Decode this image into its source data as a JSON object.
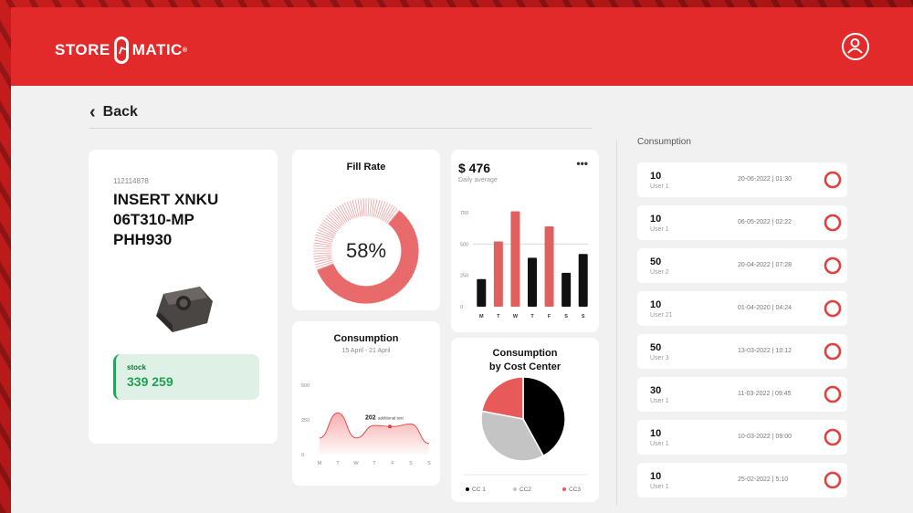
{
  "header": {
    "logo_left": "STORE",
    "logo_right": "MATIC",
    "logo_reg": "®"
  },
  "nav": {
    "back_label": "Back"
  },
  "product": {
    "code": "112114878",
    "name_lines": [
      "INSERT XNKU",
      "06T310-MP",
      "PHH930"
    ],
    "stock_label": "stock",
    "stock_value": "339 259"
  },
  "fill_rate": {
    "title": "Fill Rate",
    "percent": 58,
    "label": "58%"
  },
  "daily_average": {
    "amount": "$ 476",
    "subtitle": "Daily average",
    "menu": "•••",
    "chart_data": {
      "type": "bar",
      "categories": [
        "M",
        "T",
        "W",
        "T",
        "F",
        "S",
        "S"
      ],
      "series": [
        {
          "color": "#111111",
          "values": [
            220,
            0,
            0,
            390,
            0,
            270,
            420
          ]
        },
        {
          "color": "#e06060",
          "values": [
            0,
            520,
            760,
            0,
            640,
            0,
            0
          ]
        }
      ],
      "values": [
        220,
        520,
        760,
        390,
        640,
        270,
        420
      ],
      "colors": [
        "#111111",
        "#e06060",
        "#e06060",
        "#111111",
        "#e06060",
        "#111111",
        "#111111"
      ],
      "yticks": [
        "750",
        "500",
        "250",
        "0"
      ],
      "ylim": [
        0,
        800
      ]
    }
  },
  "consumption_chart": {
    "title": "Consumption",
    "range": "15 April - 21 April",
    "annotation_value": "202",
    "annotation_text": "additional text",
    "chart_data": {
      "type": "area",
      "categories": [
        "M",
        "T",
        "W",
        "T",
        "F",
        "S",
        "S"
      ],
      "values": [
        120,
        300,
        120,
        210,
        202,
        220,
        80
      ],
      "yticks": [
        "500",
        "250",
        "0"
      ],
      "ylim": [
        0,
        500
      ],
      "color": "#e84a4a"
    }
  },
  "cost_center": {
    "title_lines": [
      "Consumption",
      "by Cost Center"
    ],
    "chart_data": {
      "type": "pie",
      "labels": [
        "CC 1",
        "CC2",
        "CC3"
      ],
      "values": [
        42,
        36,
        22
      ],
      "colors": [
        "#000000",
        "#c4c4c4",
        "#e85a5a"
      ]
    }
  },
  "consumption_list": {
    "title": "Consumption",
    "ring_color": "#e34040",
    "items": [
      {
        "qty": "10",
        "user": "User 1",
        "datetime": "20-06-2022  |  01:30"
      },
      {
        "qty": "10",
        "user": "User 1",
        "datetime": "06-05-2022  |  02:22"
      },
      {
        "qty": "50",
        "user": "User 2",
        "datetime": "20-04-2022  |  07:28"
      },
      {
        "qty": "10",
        "user": "User 21",
        "datetime": "01-04-2020  |  04:24"
      },
      {
        "qty": "50",
        "user": "User 3",
        "datetime": "13-03-2022  |  10:12"
      },
      {
        "qty": "30",
        "user": "User 1",
        "datetime": "11-03-2022  |  09:45"
      },
      {
        "qty": "10",
        "user": "User 1",
        "datetime": "10-03-2022  |  09:00"
      },
      {
        "qty": "10",
        "user": "User 1",
        "datetime": "25-02-2022  |  5:10"
      }
    ]
  },
  "colors": {
    "brand_red": "#e32a2a",
    "accent_red": "#e06060",
    "stock_green": "#1ea050"
  }
}
